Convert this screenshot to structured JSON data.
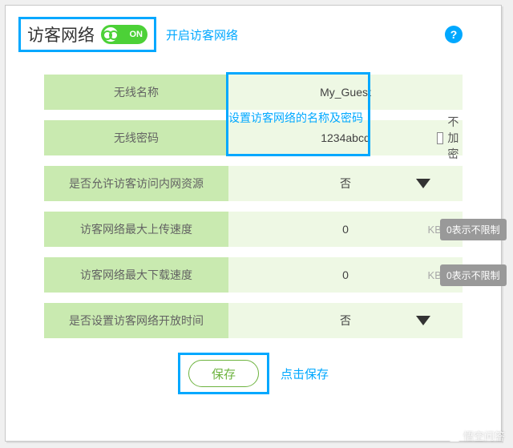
{
  "header": {
    "title": "访客网络",
    "toggle_state": "ON",
    "hint": "开启访客网络",
    "help": "?"
  },
  "rows": {
    "ssid": {
      "label": "无线名称",
      "value": "My_Guest"
    },
    "password": {
      "label": "无线密码",
      "value": "1234abcd",
      "no_encrypt": "不加密"
    },
    "combo_hint": "设置访客网络的名称及密码",
    "allow_intranet": {
      "label": "是否允许访客访问内网资源",
      "value": "否"
    },
    "upload": {
      "label": "访客网络最大上传速度",
      "value": "0",
      "unit": "KB/s",
      "note": "0表示不限制"
    },
    "download": {
      "label": "访客网络最大下载速度",
      "value": "0",
      "unit": "KB/s",
      "note": "0表示不限制"
    },
    "open_time": {
      "label": "是否设置访客网络开放时间",
      "value": "否"
    }
  },
  "footer": {
    "save": "保存",
    "hint": "点击保存"
  },
  "watermark": "悟空问答"
}
